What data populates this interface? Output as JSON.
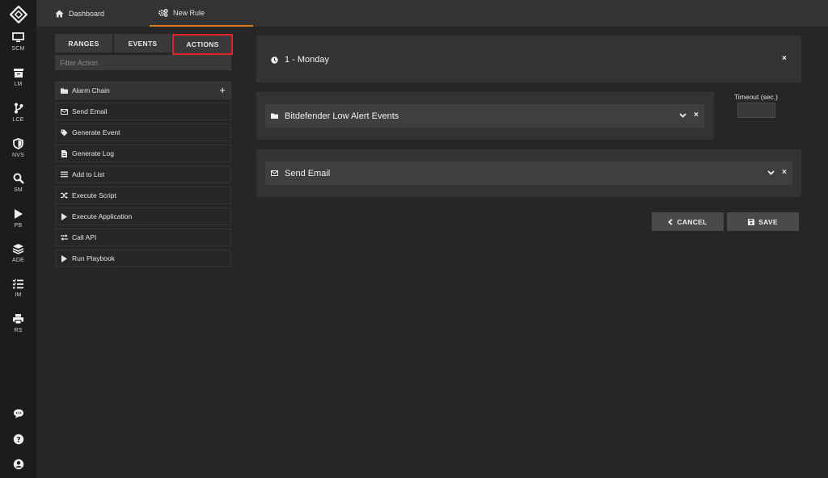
{
  "nav": {
    "items": [
      {
        "label": "SCM",
        "icon": "monitor-icon"
      },
      {
        "label": "LM",
        "icon": "archive-icon"
      },
      {
        "label": "LCE",
        "icon": "branch-icon"
      },
      {
        "label": "NVS",
        "icon": "shield-icon"
      },
      {
        "label": "SM",
        "icon": "search-icon"
      },
      {
        "label": "PB",
        "icon": "play-icon"
      },
      {
        "label": "ADE",
        "icon": "layers-icon"
      },
      {
        "label": "IM",
        "icon": "checklist-icon"
      },
      {
        "label": "RS",
        "icon": "printer-icon"
      }
    ],
    "bottom": [
      "chat-icon",
      "help-icon",
      "user-icon"
    ]
  },
  "tabs": [
    {
      "label": "Dashboard",
      "icon": "home-icon"
    },
    {
      "label": "New Rule",
      "icon": "gears-icon",
      "active": true
    }
  ],
  "left_panel": {
    "segments": [
      "RANGES",
      "EVENTS",
      "ACTIONS"
    ],
    "selected_segment": "ACTIONS",
    "filter_placeholder": "Filter Action",
    "actions": [
      {
        "label": "Alarm Chain",
        "icon": "folder-icon"
      },
      {
        "label": "Send Email",
        "icon": "envelope-icon"
      },
      {
        "label": "Generate Event",
        "icon": "tag-icon"
      },
      {
        "label": "Generate Log",
        "icon": "file-icon"
      },
      {
        "label": "Add to List",
        "icon": "list-icon"
      },
      {
        "label": "Execute Script",
        "icon": "shuffle-icon"
      },
      {
        "label": "Execute Application",
        "icon": "play-icon"
      },
      {
        "label": "Call API",
        "icon": "exchange-icon"
      },
      {
        "label": "Run Playbook",
        "icon": "play-icon"
      }
    ],
    "add_symbol": "+"
  },
  "rule": {
    "range": {
      "title": "1 - Monday",
      "icon": "clock-icon"
    },
    "event": {
      "title": "Bitdefender Low Alert Events",
      "icon": "folder-icon"
    },
    "timeout_label": "Timeout (sec.)",
    "timeout_value": "",
    "action": {
      "title": "Send Email",
      "icon": "envelope-icon"
    },
    "close_symbol": "×"
  },
  "buttons": {
    "cancel": "CANCEL",
    "save": "SAVE"
  },
  "colors": {
    "accent": "#e07b18",
    "selection_outline": "#e0202b"
  }
}
